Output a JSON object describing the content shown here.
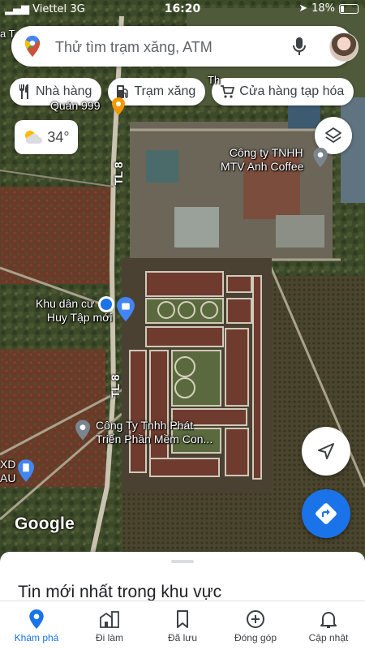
{
  "status": {
    "carrier": "Viettel",
    "network": "3G",
    "time": "16:20",
    "battery": "18%",
    "battery_level": 0.18
  },
  "search": {
    "placeholder": "Thử tìm trạm xăng, ATM"
  },
  "chips": [
    {
      "label": "Nhà hàng",
      "icon": "restaurant-icon"
    },
    {
      "label": "Trạm xăng",
      "icon": "gas-station-icon"
    },
    {
      "label": "Cửa hàng tạp hóa",
      "icon": "cart-icon"
    }
  ],
  "weather": {
    "temp": "34°",
    "icon": "partly-cloudy-icon"
  },
  "map": {
    "labels": {
      "place1": "Quán 999",
      "company1_line1": "Công ty TNHH",
      "company1_line2": "MTV Anh Coffee",
      "residential_line1": "Khu dân cư",
      "residential_line2": "Huy Tập mới",
      "company2_line1": "Công Ty Tnhh Phát",
      "company2_line2": "Triển Phần Mềm Con...",
      "xd_line1": "XD",
      "xd_line2": "AU",
      "road_top": "TL 8",
      "road_bottom": "TL 8",
      "google": "Google",
      "partial_top_left": "a T",
      "partial_top_center": "Th"
    }
  },
  "sheet": {
    "title": "Tin mới nhất trong khu vực"
  },
  "nav": [
    {
      "label": "Khám phá",
      "icon": "explore-pin-icon",
      "active": true
    },
    {
      "label": "Đi làm",
      "icon": "commute-icon",
      "active": false
    },
    {
      "label": "Đã lưu",
      "icon": "bookmark-icon",
      "active": false
    },
    {
      "label": "Đóng góp",
      "icon": "add-circle-icon",
      "active": false
    },
    {
      "label": "Cập nhật",
      "icon": "bell-icon",
      "active": false
    }
  ],
  "colors": {
    "accent": "#1a73e8",
    "map_base": "#3b3a2c"
  }
}
